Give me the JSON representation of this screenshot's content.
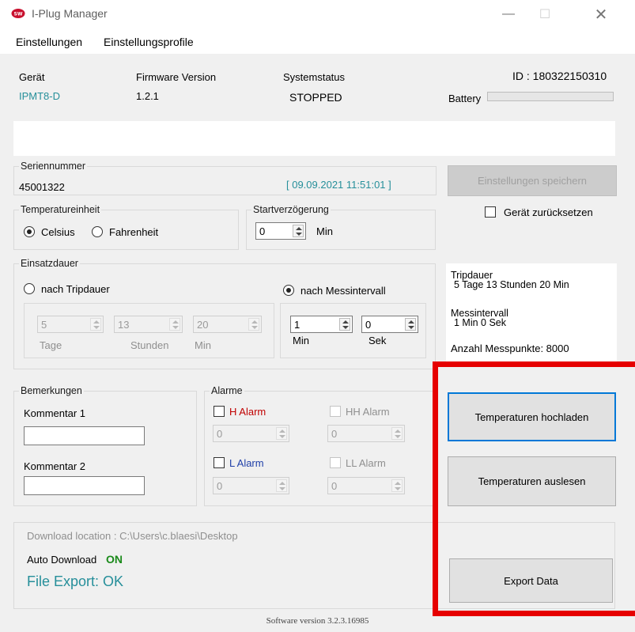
{
  "window": {
    "title": "I-Plug Manager"
  },
  "menu": {
    "items": [
      "Einstellungen",
      "Einstellungsprofile"
    ]
  },
  "header": {
    "device_label": "Gerät",
    "device_value": "IPMT8-D",
    "firmware_label": "Firmware Version",
    "firmware_value": "1.2.1",
    "system_status_label": "Systemstatus",
    "system_status_value": "STOPPED",
    "id_text": "ID :  180322150310",
    "battery_label": "Battery",
    "battery_level": 0
  },
  "serial": {
    "legend": "Seriennummer",
    "value": "45001322",
    "timestamp": "[ 09.09.2021 11:51:01 ]"
  },
  "buttons": {
    "save_settings": "Einstellungen speichern",
    "upload_temps": "Temperaturen hochladen",
    "read_temps": "Temperaturen auslesen",
    "export_data": "Export Data"
  },
  "reset": {
    "label": "Gerät zurücksetzen",
    "checked": false
  },
  "temperature_unit": {
    "legend": "Temperatureinheit",
    "celsius": "Celsius",
    "fahrenheit": "Fahrenheit",
    "selected": "Celsius"
  },
  "start_delay": {
    "legend": "Startverzögerung",
    "value": "0",
    "unit": "Min"
  },
  "deployment": {
    "legend": "Einsatzdauer",
    "trip_option": "nach Tripdauer",
    "interval_option": "nach Messintervall",
    "selected": "nach Messintervall",
    "trip_days": "5",
    "trip_hours": "13",
    "trip_min": "20",
    "days_label": "Tage",
    "hours_label": "Stunden",
    "min_label": "Min",
    "interval_min": "1",
    "interval_sec": "0",
    "interval_min_label": "Min",
    "interval_sec_label": "Sek"
  },
  "info": {
    "trip_title": "Tripdauer",
    "trip_value": "5 Tage 13 Stunden 20 Min",
    "interval_title": "Messintervall",
    "interval_value": "1 Min 0 Sek",
    "points": "Anzahl Messpunkte: 8000"
  },
  "remarks": {
    "legend": "Bemerkungen",
    "comment1_label": "Kommentar 1",
    "comment1_value": "",
    "comment2_label": "Kommentar 2",
    "comment2_value": ""
  },
  "alarms": {
    "legend": "Alarme",
    "h_label": "H Alarm",
    "hh_label": "HH Alarm",
    "l_label": "L Alarm",
    "ll_label": "LL Alarm",
    "h_value": "0",
    "hh_value": "0",
    "l_value": "0",
    "ll_value": "0"
  },
  "download": {
    "location": "Download location : C:\\Users\\c.blaesi\\Desktop",
    "auto_label": "Auto Download",
    "auto_value": "ON",
    "export_status": "File Export: OK"
  },
  "footer": {
    "version": "Software version 3.2.3.16985"
  },
  "colors": {
    "accent_teal": "#268f9a",
    "alarm_red": "#c00000",
    "alarm_blue": "#1f3fa8",
    "on_green": "#1a8a1a",
    "highlight_red": "#e60000",
    "focus_blue": "#0078d7"
  }
}
